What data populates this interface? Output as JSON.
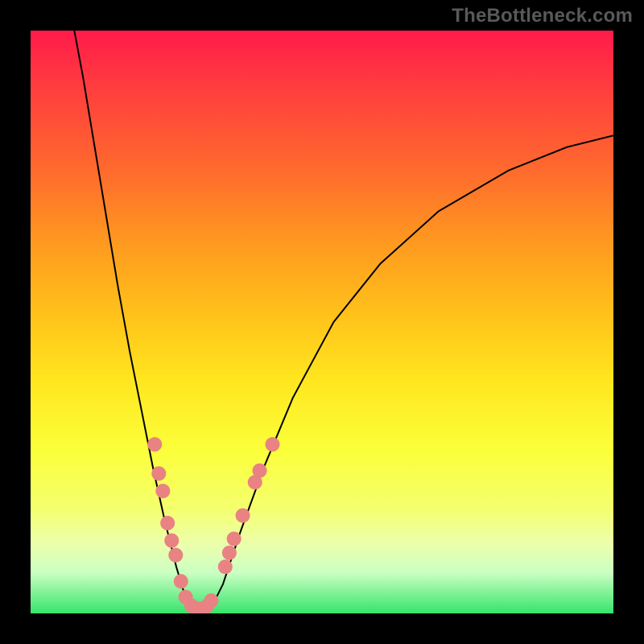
{
  "watermark": "TheBottleneck.com",
  "chart_data": {
    "type": "line",
    "title": "",
    "xlabel": "",
    "ylabel": "",
    "xlim": [
      0,
      100
    ],
    "ylim": [
      0,
      100
    ],
    "curve": {
      "name": "bottleneck-curve",
      "description": "V-shaped bottleneck percentage curve",
      "points": [
        {
          "x": 7.5,
          "y": 100.0
        },
        {
          "x": 9.0,
          "y": 92.0
        },
        {
          "x": 11.0,
          "y": 80.0
        },
        {
          "x": 13.0,
          "y": 68.0
        },
        {
          "x": 15.0,
          "y": 56.0
        },
        {
          "x": 17.0,
          "y": 45.0
        },
        {
          "x": 19.0,
          "y": 35.0
        },
        {
          "x": 21.0,
          "y": 25.0
        },
        {
          "x": 23.0,
          "y": 16.0
        },
        {
          "x": 25.0,
          "y": 8.0
        },
        {
          "x": 26.5,
          "y": 3.0
        },
        {
          "x": 28.0,
          "y": 0.6
        },
        {
          "x": 29.5,
          "y": 0.3
        },
        {
          "x": 31.0,
          "y": 1.0
        },
        {
          "x": 33.0,
          "y": 5.0
        },
        {
          "x": 36.0,
          "y": 14.0
        },
        {
          "x": 40.0,
          "y": 25.0
        },
        {
          "x": 45.0,
          "y": 37.0
        },
        {
          "x": 52.0,
          "y": 50.0
        },
        {
          "x": 60.0,
          "y": 60.0
        },
        {
          "x": 70.0,
          "y": 69.0
        },
        {
          "x": 82.0,
          "y": 76.0
        },
        {
          "x": 92.0,
          "y": 80.0
        },
        {
          "x": 100.0,
          "y": 82.0
        }
      ]
    },
    "markers": {
      "name": "highlighted-points",
      "color": "#e98282",
      "radius": 9,
      "points": [
        {
          "x": 21.3,
          "y": 29.0
        },
        {
          "x": 22.0,
          "y": 24.0
        },
        {
          "x": 22.7,
          "y": 21.0
        },
        {
          "x": 23.5,
          "y": 15.5
        },
        {
          "x": 24.2,
          "y": 12.5
        },
        {
          "x": 24.9,
          "y": 10.0
        },
        {
          "x": 25.8,
          "y": 5.5
        },
        {
          "x": 26.6,
          "y": 2.8
        },
        {
          "x": 27.6,
          "y": 1.3
        },
        {
          "x": 28.5,
          "y": 0.8
        },
        {
          "x": 29.4,
          "y": 0.8
        },
        {
          "x": 30.2,
          "y": 1.2
        },
        {
          "x": 31.0,
          "y": 2.2
        },
        {
          "x": 33.4,
          "y": 8.0
        },
        {
          "x": 34.1,
          "y": 10.4
        },
        {
          "x": 34.9,
          "y": 12.8
        },
        {
          "x": 36.4,
          "y": 16.8
        },
        {
          "x": 38.5,
          "y": 22.5
        },
        {
          "x": 39.3,
          "y": 24.5
        },
        {
          "x": 41.5,
          "y": 29.0
        }
      ]
    }
  }
}
